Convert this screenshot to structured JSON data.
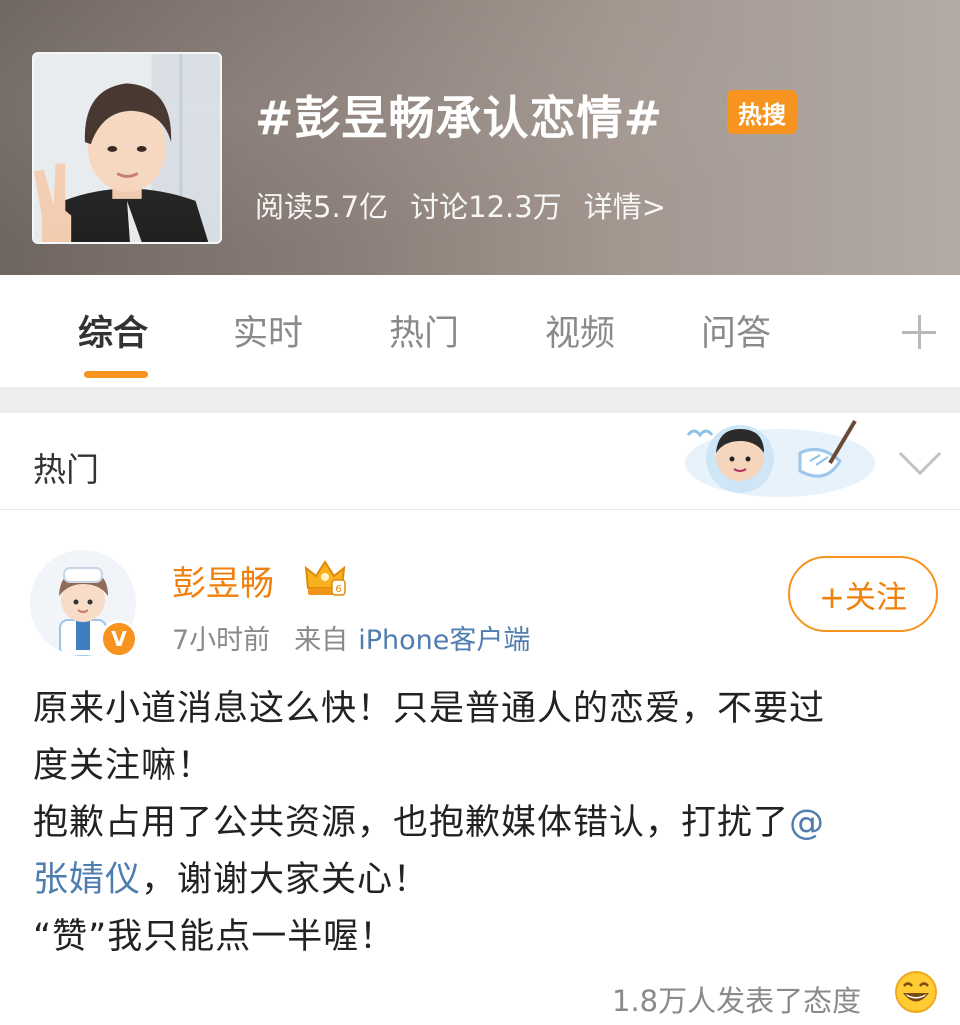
{
  "topic": {
    "title": "#彭昱畅承认恋情#",
    "badge": "热搜",
    "stats": {
      "reads": "阅读5.7亿",
      "discussions": "讨论12.3万",
      "details": "详情>"
    },
    "cover_icon": "person-v-sign-photo"
  },
  "tabs": [
    {
      "label": "综合",
      "active": true
    },
    {
      "label": "实时",
      "active": false
    },
    {
      "label": "热门",
      "active": false
    },
    {
      "label": "视频",
      "active": false
    },
    {
      "label": "问答",
      "active": false
    }
  ],
  "tabs_more_icon": "plus-icon",
  "section": {
    "title": "热门",
    "collapse_icon": "chevron-down-icon"
  },
  "post": {
    "author": "彭昱畅",
    "verified": true,
    "author_badge_icon": "crown-icon",
    "time": "7小时前",
    "source_prefix": "来自",
    "source": "iPhone客户端",
    "follow_label": "+关注",
    "lines": {
      "l1": "原来小道消息这么快！只是普通人的恋爱，不要过",
      "l2": "度关注嘛！",
      "l3": "抱歉占用了公共资源，也抱歉媒体错认，打扰了",
      "l3_mention_at": "@",
      "l4_mention": "张婧仪",
      "l4_rest": "，谢谢大家关心！",
      "l5": "“赞”我只能点一半喔！"
    },
    "reactions": "1.8万人发表了态度",
    "reaction_icon": "laugh-emoji-icon"
  },
  "colors": {
    "accent": "#f7931e",
    "link": "#507daf",
    "author_name": "#f0800b"
  }
}
